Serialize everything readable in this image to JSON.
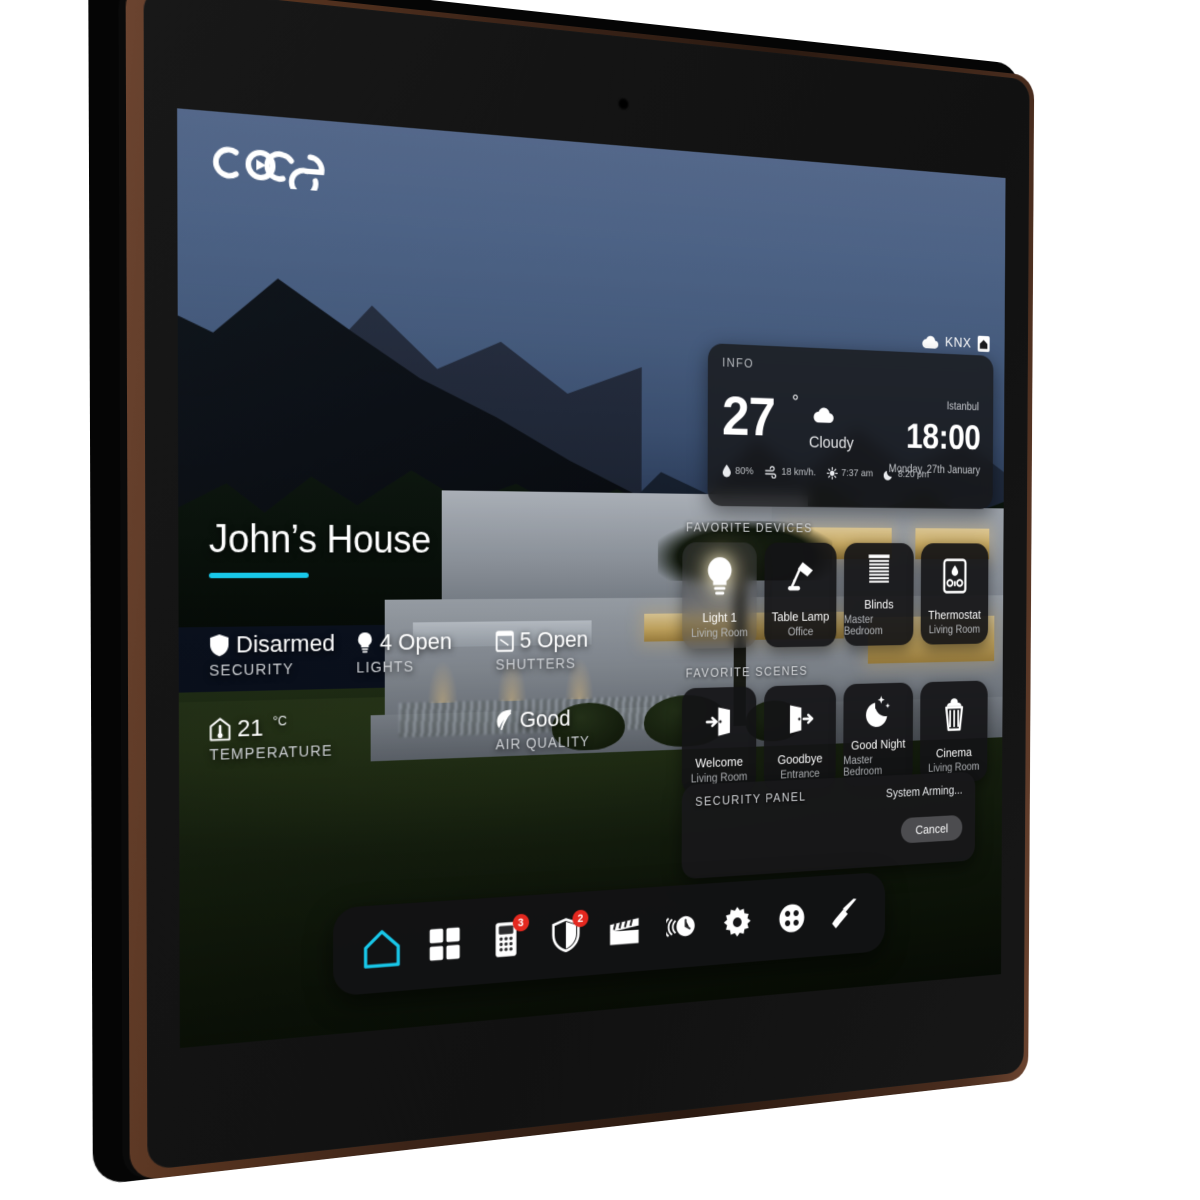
{
  "brand": {
    "logo_text": "core"
  },
  "statusbar": {
    "network_label": "KNX",
    "cloud_icon": "cloud-icon",
    "app_icon": "home-app-icon"
  },
  "info": {
    "title": "INFO",
    "temperature": "27",
    "degree": "°",
    "condition": "Cloudy",
    "weather_icon": "cloud-icon",
    "humidity": "80%",
    "wind": "18 km/h.",
    "sunrise": "7:37 am",
    "sunset": "8:20 pm",
    "city": "Istanbul",
    "time": "18:00",
    "date": "Monday, 27th January"
  },
  "home": {
    "title": "John’s House",
    "accent_color": "#18c8ea",
    "stats": [
      {
        "icon": "shield-icon",
        "value": "Disarmed",
        "label": "SECURITY"
      },
      {
        "icon": "bulb-icon",
        "value": "4 Open",
        "label": "LIGHTS"
      },
      {
        "icon": "shutter-icon",
        "value": "5 Open",
        "label": "SHUTTERS"
      },
      {
        "icon": "thermometer-icon",
        "value": "21",
        "unit": "°C",
        "label": "TEMPERATURE"
      },
      {
        "icon": "leaf-icon",
        "value": "Good",
        "label": "AIR QUALITY"
      }
    ]
  },
  "favorite_devices": {
    "title": "FAVORITE DEVICES",
    "items": [
      {
        "name": "Light 1",
        "room": "Living Room",
        "icon": "lightbulb-icon",
        "active": true
      },
      {
        "name": "Table Lamp",
        "room": "Office",
        "icon": "desk-lamp-icon",
        "active": false
      },
      {
        "name": "Blinds",
        "room": "Master Bedroom",
        "icon": "blinds-icon",
        "active": false
      },
      {
        "name": "Thermostat",
        "room": "Living Room",
        "icon": "thermostat-icon",
        "active": false
      }
    ]
  },
  "favorite_scenes": {
    "title": "FAVORITE SCENES",
    "items": [
      {
        "name": "Welcome",
        "room": "Living Room",
        "icon": "door-enter-icon"
      },
      {
        "name": "Goodbye",
        "room": "Entrance",
        "icon": "door-exit-icon"
      },
      {
        "name": "Good Night",
        "room": "Master Bedroom",
        "icon": "moon-stars-icon"
      },
      {
        "name": "Cinema",
        "room": "Living Room",
        "icon": "popcorn-icon"
      }
    ]
  },
  "security_panel": {
    "title": "SECURITY PANEL",
    "status": "System Arming...",
    "cancel_label": "Cancel"
  },
  "dock": {
    "items": [
      {
        "icon": "home-icon",
        "name": "home",
        "active": true,
        "badge": ""
      },
      {
        "icon": "grid-icon",
        "name": "rooms",
        "active": false,
        "badge": ""
      },
      {
        "icon": "intercom-icon",
        "name": "intercom",
        "active": false,
        "badge": "3"
      },
      {
        "icon": "shield-icon",
        "name": "security",
        "active": false,
        "badge": "2"
      },
      {
        "icon": "clapperboard-icon",
        "name": "media",
        "active": false,
        "badge": ""
      },
      {
        "icon": "scheduler-icon",
        "name": "scheduler",
        "active": false,
        "badge": ""
      },
      {
        "icon": "gear-icon",
        "name": "settings",
        "active": false,
        "badge": ""
      },
      {
        "icon": "automation-icon",
        "name": "automation",
        "active": false,
        "badge": ""
      },
      {
        "icon": "vacuum-icon",
        "name": "cleaning",
        "active": false,
        "badge": ""
      }
    ],
    "badge_color": "#e4281f",
    "active_color": "#18c8ea"
  }
}
